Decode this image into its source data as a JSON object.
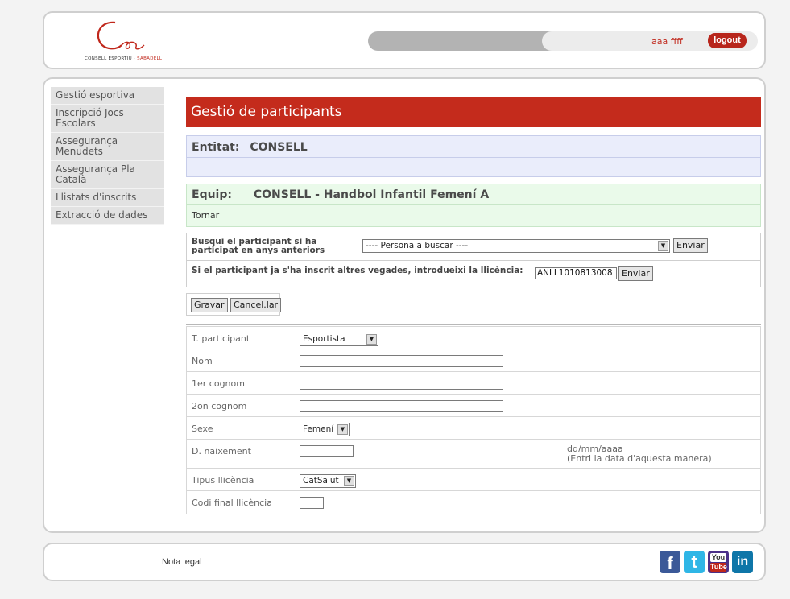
{
  "header": {
    "logo_text_black": "CONSELL ESPORTIU ·",
    "logo_text_red": " SABADELL",
    "user_name": "aaa ffff",
    "logout_label": "logout"
  },
  "sidebar": {
    "items": [
      {
        "label": "Gestió esportiva"
      },
      {
        "label": "Inscripció Jocs Escolars"
      },
      {
        "label": "Assegurança Menudets"
      },
      {
        "label": "Assegurança Pla Català"
      },
      {
        "label": "Llistats d'inscrits"
      },
      {
        "label": "Extracció de dades"
      }
    ]
  },
  "main": {
    "title": "Gestió de participants",
    "entitat_label": "Entitat:",
    "entitat_value": "CONSELL",
    "equip_label": "Equip:",
    "equip_value": "CONSELL - Handbol Infantil Femení A",
    "tornar_link": "Tornar",
    "search": {
      "label": "Busqui el participant si ha participat en anys anteriors",
      "select_value": "---- Persona a buscar ----",
      "enviar_label": "Enviar"
    },
    "licence": {
      "label": "Si el participant ja s'ha inscrit altres vegades, introdueixi la llicència:",
      "value": "ANLL1010813008",
      "enviar_label": "Enviar"
    },
    "gravar_label": "Gravar",
    "cancel_label": "Cancel.lar",
    "form": {
      "tparticipant_label": "T. participant",
      "tparticipant_value": "Esportista",
      "nom_label": "Nom",
      "cognom1_label": "1er cognom",
      "cognom2_label": "2on cognom",
      "sexe_label": "Sexe",
      "sexe_value": "Femení",
      "naixement_label": "D. naixement",
      "date_hint": "dd/mm/aaaa",
      "date_hint2": "(Entri la data d'aquesta manera)",
      "llicencia_label": "Tipus llicència",
      "llicencia_value": "CatSalut",
      "codi_label": "Codi final llicència"
    }
  },
  "footer": {
    "nota_legal": "Nota legal",
    "social": {
      "facebook": "f",
      "twitter": "t",
      "youtube_top": "You",
      "youtube_bottom": "Tube",
      "linkedin": "in"
    }
  }
}
